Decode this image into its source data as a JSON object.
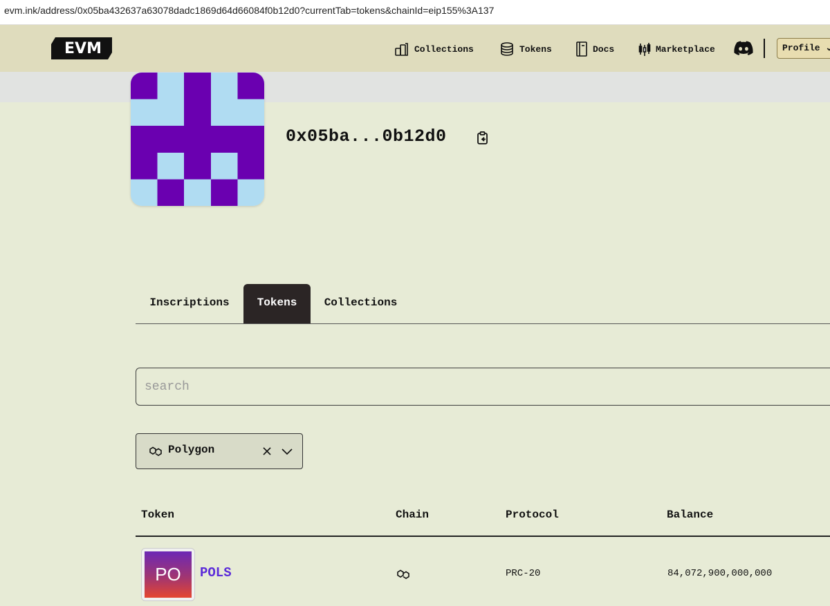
{
  "browser": {
    "url": "evm.ink/address/0x05ba432637a63078dadc1869d64d66084f0b12d0?currentTab=tokens&chainId=eip155%3A137"
  },
  "header": {
    "logo_text": "EVM",
    "nav": [
      {
        "label": "Collections",
        "icon": "collections-icon"
      },
      {
        "label": "Tokens",
        "icon": "coins-icon"
      },
      {
        "label": "Docs",
        "icon": "book-icon"
      },
      {
        "label": "Marketplace",
        "icon": "chart-icon"
      }
    ],
    "discord_icon": "discord-icon",
    "profile_label": "Profile ⌄"
  },
  "profile": {
    "address": "0x05ba...0b12d0",
    "avatar_colors": {
      "purple": "#6a00b0",
      "light_blue": "#b0dcf2"
    }
  },
  "tabs": [
    {
      "label": "Inscriptions",
      "active": false
    },
    {
      "label": "Tokens",
      "active": true
    },
    {
      "label": "Collections",
      "active": false
    }
  ],
  "search": {
    "placeholder": "search",
    "value": ""
  },
  "chain_filter": {
    "selected": "Polygon"
  },
  "table": {
    "columns": [
      "Token",
      "Chain",
      "Protocol",
      "Balance"
    ],
    "rows": [
      {
        "thumb_text": "PO",
        "token": "POLS",
        "chain_icon": "polygon-icon",
        "protocol": "PRC-20",
        "balance": "84,072,900,000,000"
      }
    ]
  },
  "colors": {
    "accent": "#5b2bd9",
    "header_bg": "#dfdcbd",
    "page_bg": "#e7ebd6",
    "active_tab": "#2b2525"
  }
}
